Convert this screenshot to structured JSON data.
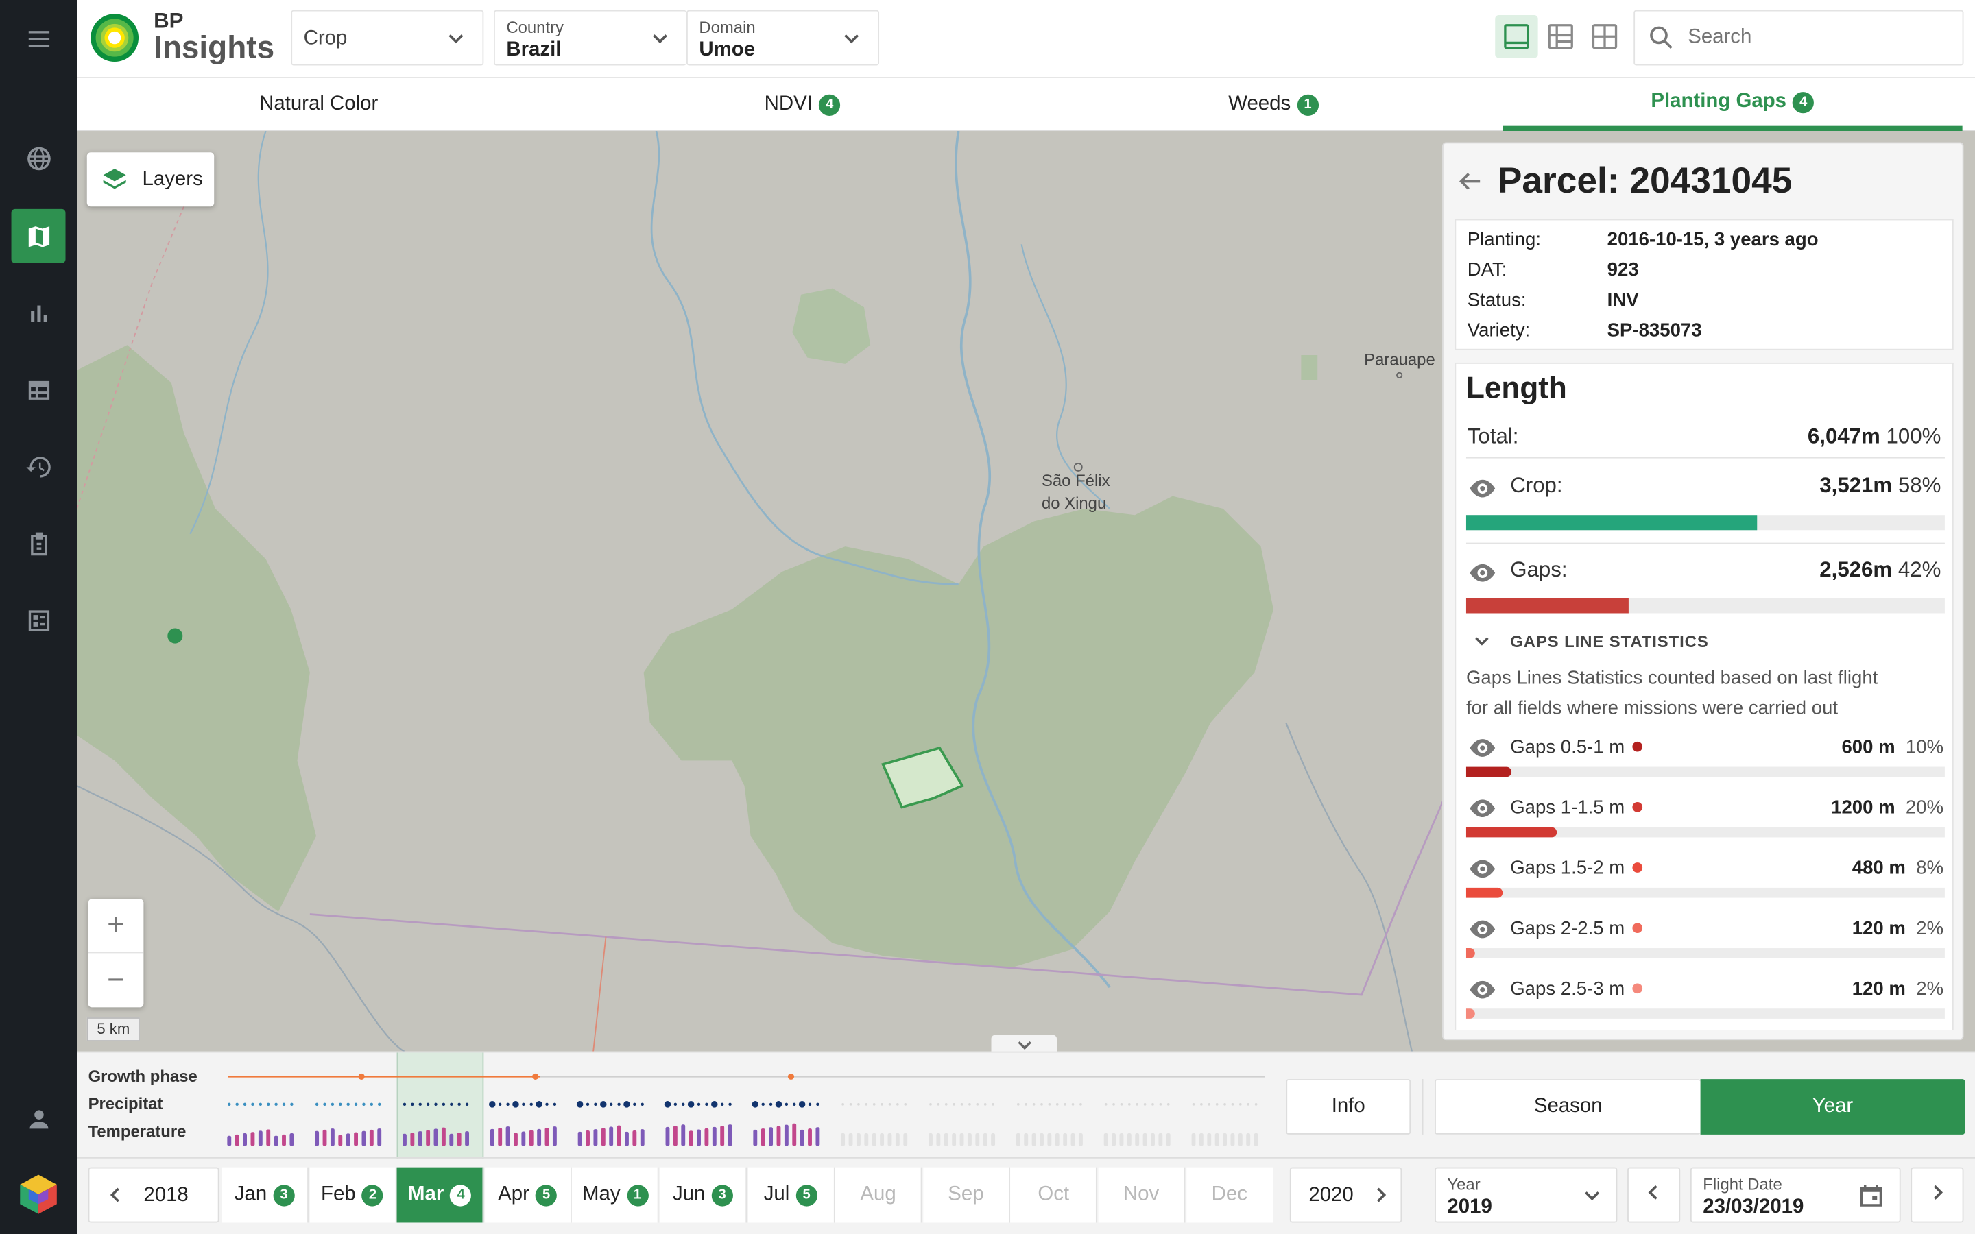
{
  "brand": {
    "line1": "BP",
    "line2": "Insights"
  },
  "header": {
    "crop": {
      "value": "Crop"
    },
    "country": {
      "label": "Country",
      "value": "Brazil"
    },
    "domain": {
      "label": "Domain",
      "value": "Umoe"
    },
    "search": {
      "placeholder": "Search"
    }
  },
  "tabs": [
    {
      "label": "Natural Color",
      "badge": ""
    },
    {
      "label": "NDVI",
      "badge": "4"
    },
    {
      "label": "Weeds",
      "badge": "1"
    },
    {
      "label": "Planting Gaps",
      "badge": "4"
    }
  ],
  "map": {
    "layers_label": "Layers",
    "scale_label": "5 km",
    "places": [
      "Parauape",
      "São Félix",
      "do Xingu"
    ]
  },
  "parcel": {
    "title": "Parcel: 20431045",
    "info": [
      {
        "key": "Planting:",
        "value": "2016-10-15, 3 years ago"
      },
      {
        "key": "DAT:",
        "value": "923"
      },
      {
        "key": "Status:",
        "value": "INV"
      },
      {
        "key": "Variety:",
        "value": "SP-835073"
      }
    ],
    "length": {
      "title": "Length",
      "total_label": "Total:",
      "total_value": "6,047m",
      "total_pct": "100%",
      "crop_label": "Crop:",
      "crop_value": "3,521m",
      "crop_pct": "58%",
      "crop_frac": 0.58,
      "gaps_label": "Gaps:",
      "gaps_value": "2,526m",
      "gaps_pct": "42%",
      "gaps_frac": 0.42
    },
    "stats": {
      "heading": "GAPS LINE STATISTICS",
      "desc1": "Gaps Lines Statistics counted based on last flight",
      "desc2": "for all fields where missions were carried out",
      "rows": [
        {
          "label": "Gaps 0.5-1 m",
          "value": "600 m",
          "pct": "10%",
          "frac": 0.1,
          "color": "#b3211f"
        },
        {
          "label": "Gaps 1-1.5 m",
          "value": "1200 m",
          "pct": "20%",
          "frac": 0.2,
          "color": "#d23a33"
        },
        {
          "label": "Gaps 1.5-2 m",
          "value": "480 m",
          "pct": "8%",
          "frac": 0.08,
          "color": "#ea4b3c"
        },
        {
          "label": "Gaps 2-2.5 m",
          "value": "120 m",
          "pct": "2%",
          "frac": 0.02,
          "color": "#f06a5b"
        },
        {
          "label": "Gaps 2.5-3 m",
          "value": "120 m",
          "pct": "2%",
          "frac": 0.02,
          "color": "#f5897c"
        }
      ]
    }
  },
  "timeline": {
    "labels": {
      "growth": "Growth phase",
      "precip": "Precipitat",
      "temp": "Temperature"
    },
    "info_label": "Info",
    "season_label": "Season",
    "year_label": "Year",
    "prev_year": "2018",
    "next_year": "2020",
    "months": [
      {
        "label": "Jan",
        "badge": "3",
        "state": "normal"
      },
      {
        "label": "Feb",
        "badge": "2",
        "state": "normal"
      },
      {
        "label": "Mar",
        "badge": "4",
        "state": "selected"
      },
      {
        "label": "Apr",
        "badge": "5",
        "state": "normal"
      },
      {
        "label": "May",
        "badge": "1",
        "state": "normal"
      },
      {
        "label": "Jun",
        "badge": "3",
        "state": "normal"
      },
      {
        "label": "Jul",
        "badge": "5",
        "state": "normal"
      },
      {
        "label": "Aug",
        "badge": "",
        "state": "disabled"
      },
      {
        "label": "Sep",
        "badge": "",
        "state": "disabled"
      },
      {
        "label": "Oct",
        "badge": "",
        "state": "disabled"
      },
      {
        "label": "Nov",
        "badge": "",
        "state": "disabled"
      },
      {
        "label": "Dec",
        "badge": "",
        "state": "disabled"
      }
    ],
    "year": {
      "label": "Year",
      "value": "2019"
    },
    "flight": {
      "label": "Flight Date",
      "value": "23/03/2019"
    }
  },
  "colors": {
    "accent": "#2e9150",
    "crop_bar": "#25a57b",
    "gaps_bar": "#c8403a",
    "sidebar": "#1b1f24"
  }
}
